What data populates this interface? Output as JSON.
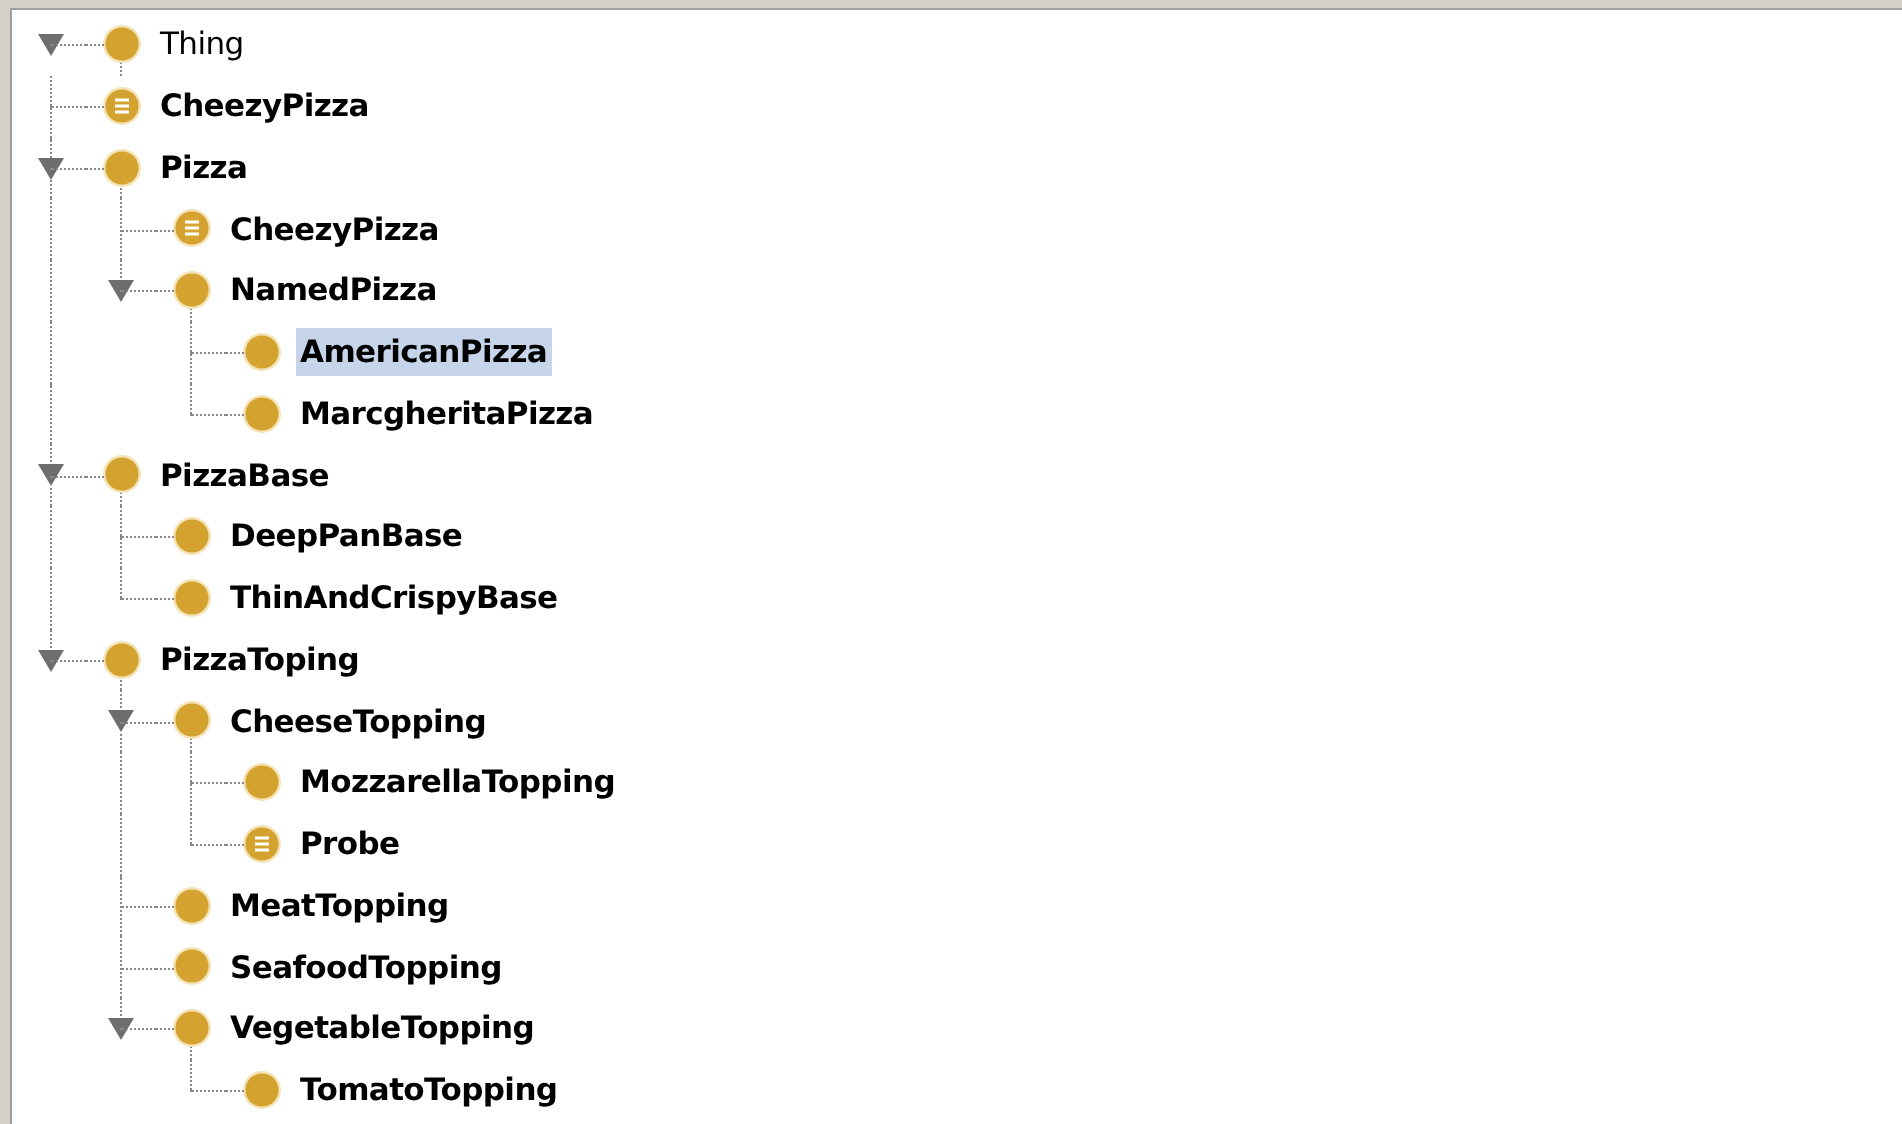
{
  "tree": {
    "label": "Thing",
    "kind": "class",
    "expanded": true,
    "selected": false,
    "children": [
      {
        "label": "CheezyPizza",
        "kind": "defined",
        "selected": false
      },
      {
        "label": "Pizza",
        "kind": "class",
        "expanded": true,
        "selected": false,
        "children": [
          {
            "label": "CheezyPizza",
            "kind": "defined",
            "selected": false
          },
          {
            "label": "NamedPizza",
            "kind": "class",
            "expanded": true,
            "selected": false,
            "children": [
              {
                "label": "AmericanPizza",
                "kind": "class",
                "selected": true
              },
              {
                "label": "MarcgheritaPizza",
                "kind": "class",
                "selected": false
              }
            ]
          }
        ]
      },
      {
        "label": "PizzaBase",
        "kind": "class",
        "expanded": true,
        "selected": false,
        "children": [
          {
            "label": "DeepPanBase",
            "kind": "class",
            "selected": false
          },
          {
            "label": "ThinAndCrispyBase",
            "kind": "class",
            "selected": false
          }
        ]
      },
      {
        "label": "PizzaToping",
        "kind": "class",
        "expanded": true,
        "selected": false,
        "children": [
          {
            "label": "CheeseTopping",
            "kind": "class",
            "expanded": true,
            "selected": false,
            "children": [
              {
                "label": "MozzarellaTopping",
                "kind": "class",
                "selected": false
              },
              {
                "label": "Probe",
                "kind": "defined",
                "selected": false
              }
            ]
          },
          {
            "label": "MeatTopping",
            "kind": "class",
            "selected": false
          },
          {
            "label": "SeafoodTopping",
            "kind": "class",
            "selected": false
          },
          {
            "label": "VegetableTopping",
            "kind": "class",
            "expanded": true,
            "selected": false,
            "children": [
              {
                "label": "TomatoTopping",
                "kind": "class",
                "selected": false
              }
            ]
          }
        ]
      }
    ]
  }
}
